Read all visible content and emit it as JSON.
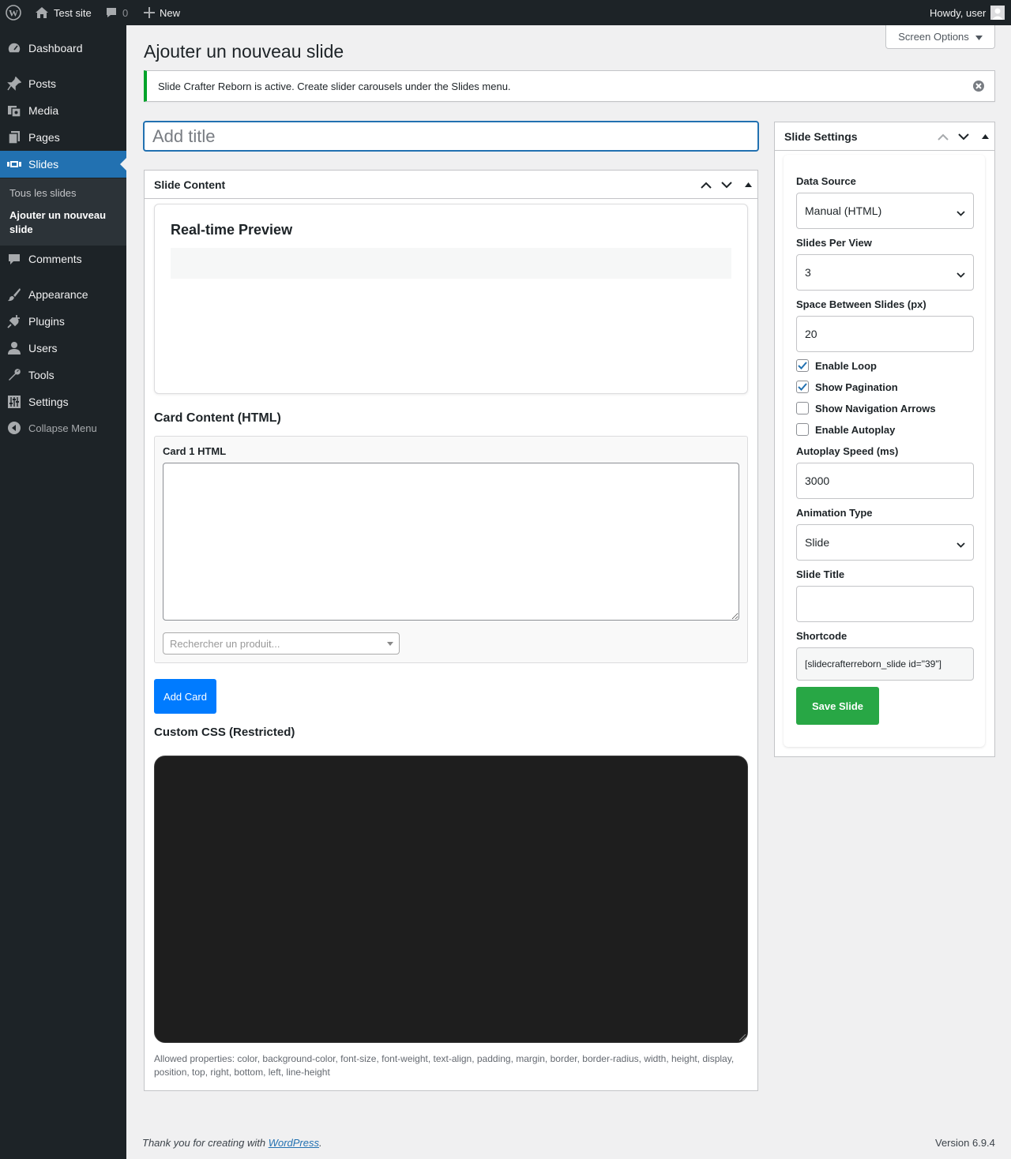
{
  "adminbar": {
    "site_name": "Test site",
    "comments_count": "0",
    "new_label": "New",
    "howdy": "Howdy, user"
  },
  "sidebar": {
    "items": [
      {
        "label": "Dashboard",
        "icon": "dashboard-icon"
      },
      {
        "label": "Posts",
        "icon": "pin-icon"
      },
      {
        "label": "Media",
        "icon": "media-icon"
      },
      {
        "label": "Pages",
        "icon": "pages-icon"
      },
      {
        "label": "Slides",
        "icon": "slides-icon"
      },
      {
        "label": "Comments",
        "icon": "comment-icon"
      },
      {
        "label": "Appearance",
        "icon": "brush-icon"
      },
      {
        "label": "Plugins",
        "icon": "plug-icon"
      },
      {
        "label": "Users",
        "icon": "user-icon"
      },
      {
        "label": "Tools",
        "icon": "wrench-icon"
      },
      {
        "label": "Settings",
        "icon": "sliders-icon"
      }
    ],
    "submenu": [
      "Tous les slides",
      "Ajouter un nouveau slide"
    ],
    "collapse_label": "Collapse Menu"
  },
  "screen_options": "Screen Options",
  "page_title": "Ajouter un nouveau slide",
  "notice_text": "Slide Crafter Reborn is active. Create slider carousels under the Slides menu.",
  "title_placeholder": "Add title",
  "slide_content": {
    "heading": "Slide Content",
    "preview_title": "Real-time Preview",
    "card_content_heading": "Card Content (HTML)",
    "card1_label": "Card 1 HTML",
    "product_search_placeholder": "Rechercher un produit...",
    "add_card_label": "Add Card",
    "custom_css_heading": "Custom CSS (Restricted)",
    "css_help": "Allowed properties: color, background-color, font-size, font-weight, text-align, padding, margin, border, border-radius, width, height, display, position, top, right, bottom, left, line-height"
  },
  "settings": {
    "heading": "Slide Settings",
    "data_source_label": "Data Source",
    "data_source_value": "Manual (HTML)",
    "slides_per_view_label": "Slides Per View",
    "slides_per_view_value": "3",
    "space_between_label": "Space Between Slides (px)",
    "space_between_value": "20",
    "checkboxes": [
      {
        "label": "Enable Loop",
        "checked": true
      },
      {
        "label": "Show Pagination",
        "checked": true
      },
      {
        "label": "Show Navigation Arrows",
        "checked": false
      },
      {
        "label": "Enable Autoplay",
        "checked": false
      }
    ],
    "autoplay_speed_label": "Autoplay Speed (ms)",
    "autoplay_speed_value": "3000",
    "animation_type_label": "Animation Type",
    "animation_type_value": "Slide",
    "slide_title_label": "Slide Title",
    "slide_title_value": "",
    "shortcode_label": "Shortcode",
    "shortcode_value": "[slidecrafterreborn_slide id=\"39\"]",
    "save_label": "Save Slide"
  },
  "footer": {
    "thanks_prefix": "Thank you for creating with ",
    "thanks_link": "WordPress",
    "thanks_suffix": ".",
    "version": "Version 6.9.4"
  },
  "colors": {
    "admin_dark": "#1d2327",
    "accent_blue": "#2271b1",
    "notice_green": "#00a32a",
    "add_card_blue": "#007bff",
    "save_green": "#28a745"
  }
}
